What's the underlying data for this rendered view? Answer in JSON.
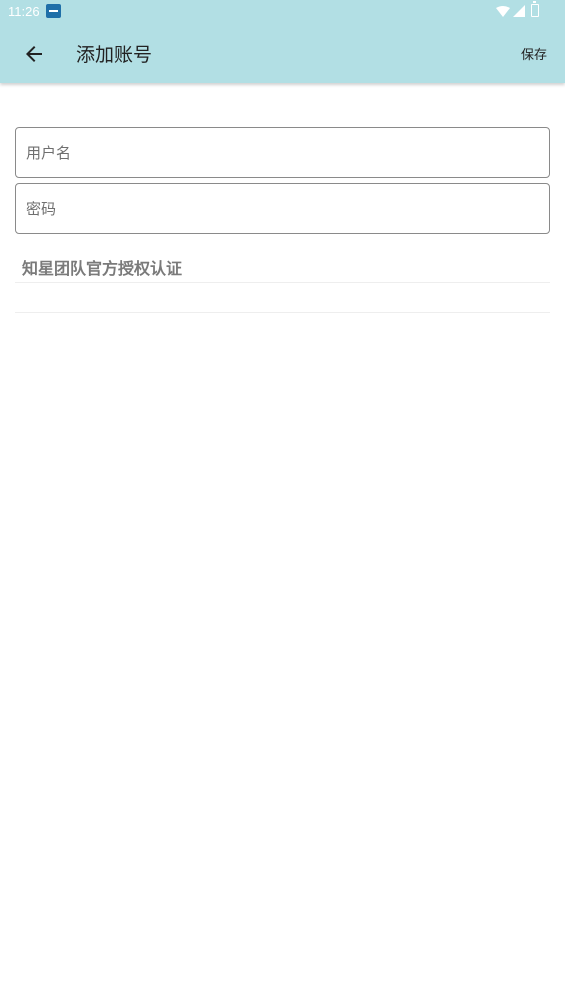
{
  "status_bar": {
    "time": "11:26",
    "notification_icon": "app-notification-icon",
    "wifi_icon": "wifi-icon",
    "signal_icon": "signal-icon",
    "battery_icon": "battery-icon"
  },
  "app_bar": {
    "back_icon": "arrow-left-icon",
    "title": "添加账号",
    "save_label": "保存",
    "background_color": "#b2dfe4"
  },
  "form": {
    "username": {
      "placeholder": "用户名",
      "value": ""
    },
    "password": {
      "placeholder": "密码",
      "value": ""
    }
  },
  "auth_text": "知星团队官方授权认证"
}
